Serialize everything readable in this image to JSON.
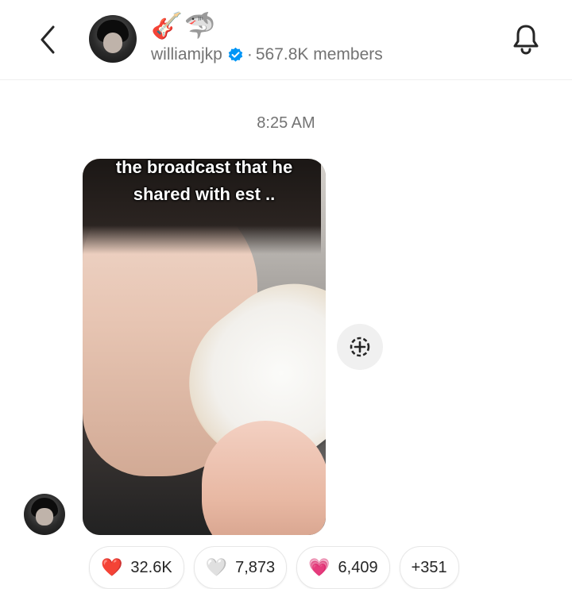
{
  "header": {
    "channel_emojis": "🎸🦈",
    "channel_name": "williamjkp",
    "separator": "·",
    "member_count": "567.8K members"
  },
  "chat": {
    "timestamp": "8:25 AM",
    "media_caption_line1": "the broadcast that he",
    "media_caption_line2": "shared with est .."
  },
  "reactions": [
    {
      "emoji": "❤️",
      "count": "32.6K"
    },
    {
      "emoji": "🤍",
      "count": "7,873"
    },
    {
      "emoji": "💗",
      "count": "6,409"
    }
  ],
  "reactions_more": "+351",
  "colors": {
    "verified": "#0095f6",
    "text": "#262626",
    "muted": "#737373"
  },
  "icons": {
    "back": "chevron-left-icon",
    "bell": "bell-icon",
    "verified": "verified-badge-icon",
    "reshare": "reshare-plus-icon"
  }
}
